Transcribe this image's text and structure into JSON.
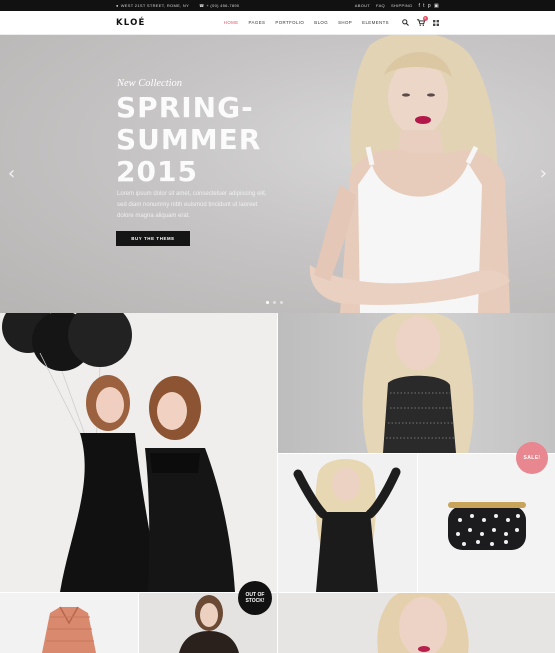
{
  "topbar": {
    "address": "WEST 21ST STREET, ROME, NY",
    "phone": "+ (00) 456-7890",
    "links": [
      "ABOUT",
      "FAQ",
      "SHIPPING"
    ],
    "social_icons": [
      "facebook-icon",
      "twitter-icon",
      "pinterest-icon",
      "instagram-icon"
    ]
  },
  "header": {
    "logo": "KLOÉ",
    "nav": [
      "HOME",
      "PAGES",
      "PORTFOLIO",
      "BLOG",
      "SHOP",
      "ELEMENTS"
    ],
    "active_nav": "HOME",
    "cart_count": "0",
    "accent": "#e24f66"
  },
  "hero": {
    "kicker": "New Collection",
    "headline_line1": "SPRING-",
    "headline_line2": "SUMMER",
    "headline_line3": "2015",
    "text": "Lorem ipsum dolor sit amet, consectetuer adipiscing elit, sed diam nonummy nibh euismod tincidunt ut laoreet dolore magna aliquam erat.",
    "button": "BUY THE THEME",
    "slides_total": 3,
    "active_slide": 1
  },
  "tiles": {
    "sale_badge": "SALE!",
    "out_of_stock_line1": "OUT OF",
    "out_of_stock_line2": "STOCK!"
  }
}
